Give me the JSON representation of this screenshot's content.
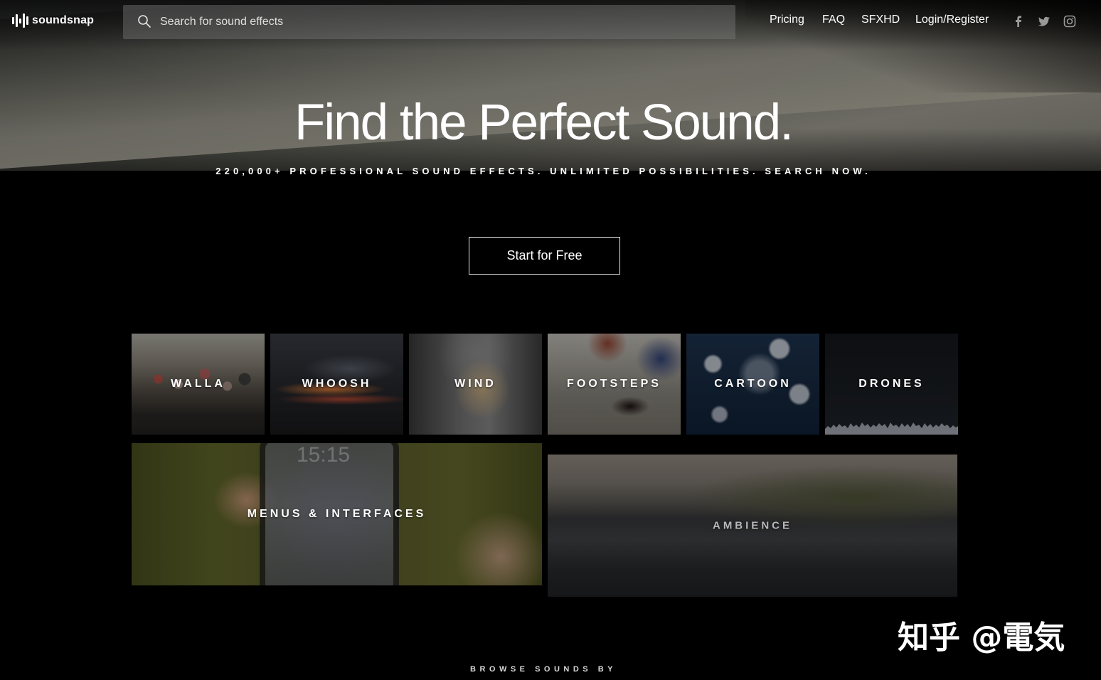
{
  "header": {
    "logo_text": "soundsnap",
    "search_placeholder": "Search for sound effects",
    "nav": {
      "pricing": "Pricing",
      "faq": "FAQ",
      "sfxhd": "SFXHD",
      "login": "Login/Register"
    },
    "social_icons": [
      "facebook-icon",
      "twitter-icon",
      "instagram-icon"
    ]
  },
  "hero": {
    "title": "Find the Perfect Sound.",
    "subtitle": "220,000+ PROFESSIONAL SOUND EFFECTS. UNLIMITED POSSIBILITIES. SEARCH NOW.",
    "cta": "Start for Free"
  },
  "categories": {
    "walla": "WALLA",
    "whoosh": "WHOOSH",
    "wind": "WIND",
    "footsteps": "FOOTSTEPS",
    "cartoon": "CARTOON",
    "drones": "DRONES",
    "menus": "MENUS & INTERFACES",
    "ambience": "AMBIENCE",
    "phone_time": "15:15"
  },
  "footer": {
    "browse": "BROWSE SOUNDS BY"
  },
  "watermark": "知乎 @電気",
  "colors": {
    "background": "#000000",
    "text": "#ffffff",
    "search_bg": "#6b6b6b"
  }
}
